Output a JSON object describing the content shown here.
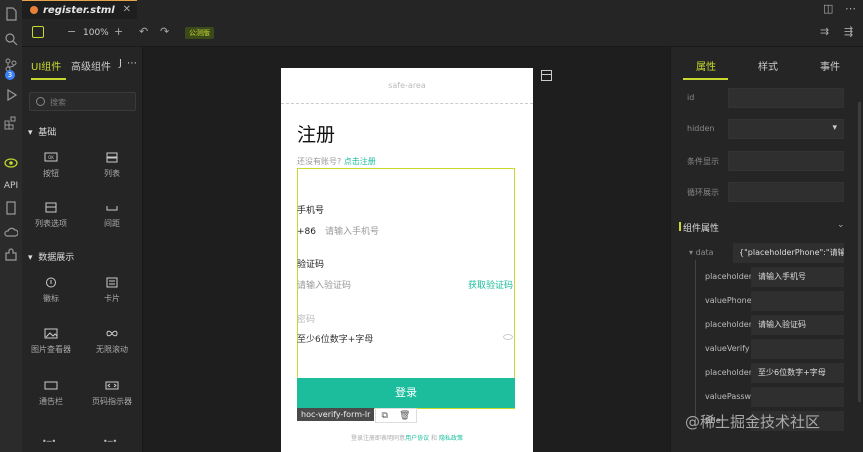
{
  "tab": {
    "filename": "register.stml"
  },
  "toolbar": {
    "zoom": "100%",
    "env_badge": "公测版",
    "minus": "−",
    "plus": "+"
  },
  "activity": {
    "api_label": "API",
    "badge": "3"
  },
  "left_panel": {
    "tabs": [
      "UI组件",
      "高级组件",
      "J"
    ],
    "search_placeholder": "搜索",
    "sections": [
      {
        "title": "基础",
        "items": [
          "按钮",
          "列表",
          "列表选项",
          "间距"
        ]
      },
      {
        "title": "数据展示",
        "items": [
          "徽标",
          "卡片",
          "图片查看器",
          "无限滚动",
          "通告栏",
          "页码指示器"
        ]
      }
    ]
  },
  "phone": {
    "safe_area": "safe-area",
    "title": "注册",
    "no_account": "还没有账号?",
    "register_link": "点击注册",
    "phone_label": "手机号",
    "country_code": "+86",
    "phone_placeholder": "请输入手机号",
    "code_label": "验证码",
    "code_placeholder": "请输入验证码",
    "get_code": "获取验证码",
    "password_label": "密码",
    "password_placeholder": "至少6位数字+字母",
    "submit": "登录",
    "selected_component": "hoc-verify-form-lr",
    "agreement_prefix": "登录注册即表明同意",
    "agreement_link1": "用户协议",
    "agreement_and": "和",
    "agreement_link2": "隐私政策"
  },
  "right_panel": {
    "tabs": [
      "属性",
      "样式",
      "事件"
    ],
    "props": [
      "id",
      "hidden",
      "条件显示",
      "循环展示"
    ],
    "group_title": "组件属性",
    "data_key": "data",
    "data_value": "{\"placeholderPhone\":\"请输",
    "data_items": [
      {
        "key": "placeholderPhone",
        "value": "请输入手机号"
      },
      {
        "key": "valuePhone",
        "value": ""
      },
      {
        "key": "placeholderVerify",
        "value": "请输入验证码"
      },
      {
        "key": "valueVerify",
        "value": ""
      },
      {
        "key": "placeholderPassword",
        "value": "至少6位数字+字母"
      },
      {
        "key": "valuePassword",
        "value": ""
      },
      {
        "key": "title",
        "value": ""
      }
    ]
  },
  "watermark": "@稀土掘金技术社区",
  "colors": {
    "accent": "#c7d92e",
    "brand": "#1bbd9d",
    "tab_dot": "#e8803a"
  }
}
